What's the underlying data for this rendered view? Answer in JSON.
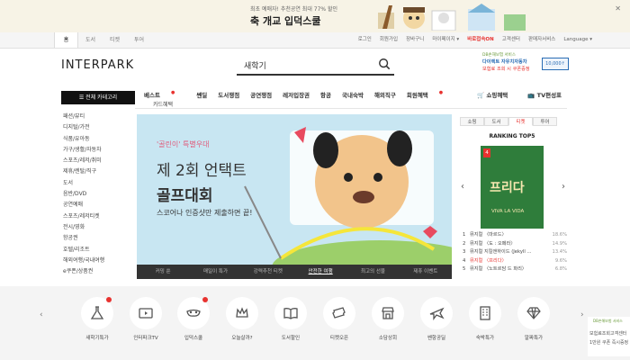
{
  "promo": {
    "small": "최초 예매자! 추천공연 최대 77% 할인",
    "big": "축 개교 입덕스쿨",
    "close": "✕"
  },
  "gnb": {
    "tabs": [
      "홈",
      "도서",
      "티켓",
      "투어"
    ],
    "links": [
      "로그인",
      "회원가입",
      "장바구니",
      "마이페이지 ▾",
      "바로접속ON",
      "고객센터",
      "판매자서비스",
      "Language ▾"
    ]
  },
  "header": {
    "logo": "INTERPARK",
    "search_value": "새학기",
    "ad": {
      "line1": "DB손해보험 서비스",
      "line2": "다이렉트 자유치자동차",
      "line3": "보험료 조회 시 쿠폰증정",
      "coupon": "10,000↑"
    }
  },
  "nav": {
    "all_category": "☰  전체 카테고리",
    "menu": [
      "베스트",
      "쎈딜",
      "도서쟁점",
      "공연쟁점",
      "레저입장권",
      "항공",
      "국내숙박",
      "해외직구",
      "회원혜택"
    ],
    "submenu": "카드혜택",
    "right": [
      "🛒 쇼핑혜택",
      "📺 TV편성표"
    ]
  },
  "categories": [
    "패션/뷰티",
    "디지털/가전",
    "식품/유아동",
    "가구/생활/자동차",
    "스포츠/레저/취미",
    "제휴/렌탈/직구",
    "도서",
    "음반/DVD",
    "공연예매",
    "스포츠/레저티켓",
    "전시/영화",
    "항공권",
    "호텔/리조트",
    "해외여행/국내여행",
    "e쿠폰/상품권"
  ],
  "banner": {
    "tagline": "'골린이' 특별우대",
    "line1": "제 2회 언택트",
    "line2": "골프대회",
    "line3": "스코어나 인증샷만 제출하면 끝!",
    "tabs": [
      "커밍 쑨",
      "매일이 특가",
      "강력추천 티켓",
      "안전한 여행",
      "최고의 선물",
      "제휴 이벤트"
    ],
    "active_tab": 3
  },
  "ranking": {
    "tabs": [
      "쇼핑",
      "도서",
      "티켓",
      "투어"
    ],
    "active_tab": 2,
    "title": "RANKING TOP5",
    "poster_rank": "4",
    "poster_title": "프리다",
    "poster_sub": "VIVA LA VIDA",
    "items": [
      {
        "num": "1",
        "title": "뮤지컬 〈마르드〉",
        "pct": "18.6%"
      },
      {
        "num": "2",
        "title": "뮤지컬 〈도 : 오페라〉",
        "pct": "14.9%"
      },
      {
        "num": "3",
        "title": "뮤지컬 지킬앤하이드 (Jekyll ...",
        "pct": "13.4%"
      },
      {
        "num": "4",
        "title": "뮤지컬 〈프리다〉",
        "pct": "9.6%"
      },
      {
        "num": "5",
        "title": "뮤지컬 〈노트르담 드 파리〉",
        "pct": "6.8%"
      }
    ],
    "highlight_index": 3
  },
  "shortcuts": [
    {
      "label": "새학기특가",
      "icon": "flask-icon",
      "dot": true
    },
    {
      "label": "인터파크TV",
      "icon": "tv-play-icon",
      "dot": false
    },
    {
      "label": "입덕스쿨",
      "icon": "mask-icon",
      "dot": true
    },
    {
      "label": "오늘살까?",
      "icon": "crown-icon",
      "dot": false
    },
    {
      "label": "도서할인",
      "icon": "book-icon",
      "dot": false
    },
    {
      "label": "티켓오픈",
      "icon": "ticket-icon",
      "dot": false
    },
    {
      "label": "소담상회",
      "icon": "shop-icon",
      "dot": false
    },
    {
      "label": "쎈항공딜",
      "icon": "airplane-icon",
      "dot": false
    },
    {
      "label": "숙박특가",
      "icon": "building-icon",
      "dot": false
    },
    {
      "label": "알짜특가",
      "icon": "diamond-icon",
      "dot": false
    }
  ],
  "side_ad": {
    "a": "DB손해보험 서비스",
    "b": "보험료조회고객센터",
    "c": "1만원 쿠폰 즉시증정"
  },
  "colors": {
    "accent": "#e8322f",
    "banner_bg": "#c8e6f2",
    "shortcut_bg": "#f4f4f4"
  }
}
